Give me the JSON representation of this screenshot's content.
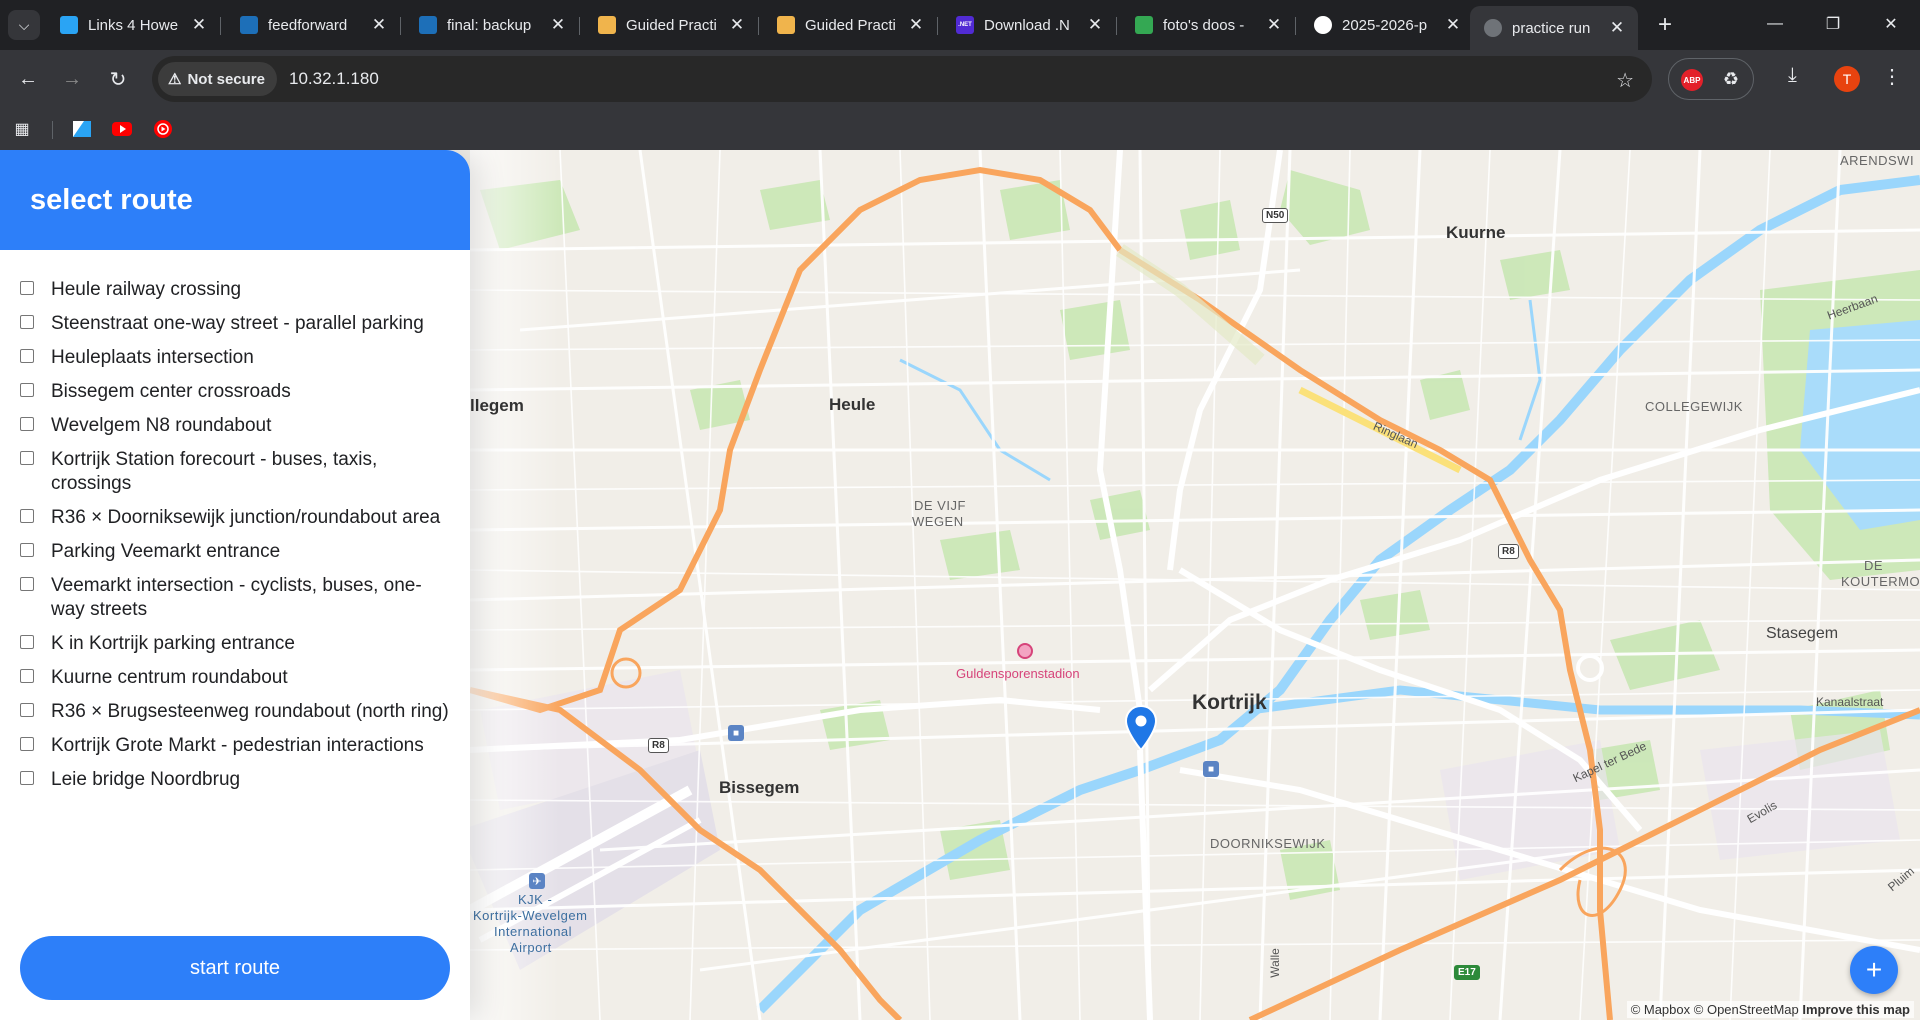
{
  "browser": {
    "tabs": [
      {
        "title": "Links 4 Howe",
        "favicon": "sheets-blue-icon"
      },
      {
        "title": "feedforward",
        "favicon": "leho-icon"
      },
      {
        "title": "final: backup",
        "favicon": "leho-icon"
      },
      {
        "title": "Guided Practi",
        "favicon": "guided-practice-icon"
      },
      {
        "title": "Guided Practi",
        "favicon": "guided-practice-icon"
      },
      {
        "title": "Download .N",
        "favicon": "dotnet-icon"
      },
      {
        "title": "foto's doos -",
        "favicon": "google-drive-icon"
      },
      {
        "title": "2025-2026-p",
        "favicon": "github-icon"
      },
      {
        "title": "practice run",
        "favicon": "globe-icon"
      }
    ],
    "active_tab_index": 8,
    "security_label": "Not secure",
    "url": "10.32.1.180",
    "dotnet_badge": ".NET",
    "abp_badge": "ABP",
    "avatar_letter": "T"
  },
  "panel": {
    "title": "select route",
    "routes": [
      "Heule railway crossing",
      "Steenstraat one-way street - parallel parking",
      "Heuleplaats intersection",
      "Bissegem center crossroads",
      "Wevelgem N8 roundabout",
      "Kortrijk Station forecourt - buses, taxis, crossings",
      "R36 × Doorniksewijk junction/roundabout area",
      "Parking Veemarkt entrance",
      "Veemarkt intersection - cyclists, buses, one-way streets",
      "K in Kortrijk parking entrance",
      "Kuurne centrum roundabout",
      "R36 × Brugsesteenweg roundabout (north ring)",
      "Kortrijk Grote Markt - pedestrian interactions",
      "Leie bridge Noordbrug"
    ],
    "start_label": "start route"
  },
  "map": {
    "places": {
      "kortrijk": "Kortrijk",
      "heule": "Heule",
      "kuurne": "Kuurne",
      "bissegem": "Bissegem",
      "ullegem": "llegem",
      "stasegem": "Stasegem"
    },
    "districts": {
      "vijf_wegen_1": "DE VIJF",
      "vijf_wegen_2": "WEGEN",
      "collegewijk": "COLLEGEWIJK",
      "doorniksewijk": "DOORNIKSEWIJK",
      "koutermolen_1": "DE",
      "koutermolen_2": "KOUTERMOLE",
      "arendswi": "ARENDSWI",
      "kjk_1": "KJK -",
      "kjk_2": "Kortrijk-Wevelgem",
      "kjk_3": "International",
      "kjk_4": "Airport"
    },
    "roads": {
      "ringlaan": "Ringlaan",
      "heerbaan": "Heerbaan",
      "kanaalstraat": "Kanaalstraat",
      "kapel_ter_bede": "Kapel ter Bede",
      "evolis": "Evolis",
      "pluim": "Pluim",
      "walle": "Walle"
    },
    "poi": {
      "stadium": "Guldensporenstadion"
    },
    "shields": {
      "n50": "N50",
      "r8_east": "R8",
      "r8_west": "R8",
      "e17": "E17"
    },
    "attribution": {
      "mapbox": "© Mapbox",
      "osm": "© OpenStreetMap",
      "improve": "Improve this map"
    },
    "colors": {
      "motorway": "#f7a35c",
      "water": "#8fd3fe",
      "park": "#c8e6b0",
      "base": "#f2efe9"
    }
  }
}
